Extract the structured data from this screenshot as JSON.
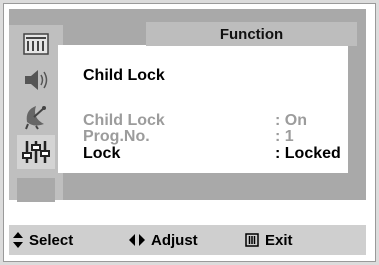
{
  "menu": {
    "title": "Function",
    "heading": "Child Lock",
    "rows": [
      {
        "label": "Child Lock",
        "value": ": On",
        "dimmed": true
      },
      {
        "label": "Prog.No.",
        "value": ":  1",
        "dimmed": true
      },
      {
        "label": "Lock",
        "value": ": Locked",
        "dimmed": false
      }
    ],
    "sidebar_icons": [
      "picture-icon",
      "sound-icon",
      "channel-icon",
      "function-icon"
    ],
    "active_icon": "function-icon"
  },
  "footer": {
    "select_label": "Select",
    "adjust_label": "Adjust",
    "exit_label": "Exit"
  },
  "colors": {
    "panel": "#a9a9a9",
    "title_bar": "#bdbdbd",
    "dimmed_text": "#9c9c9c",
    "footer_bg": "#cfcfcf"
  }
}
